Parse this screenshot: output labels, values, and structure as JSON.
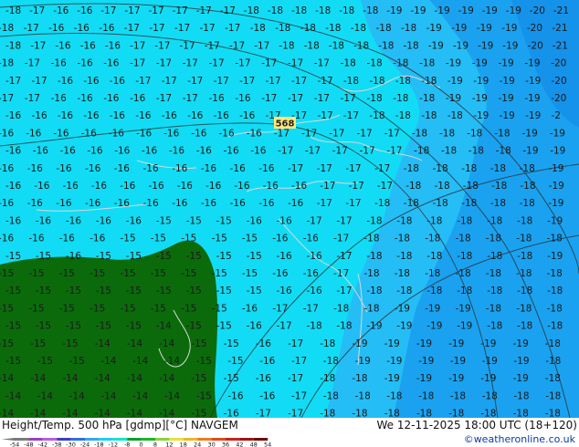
{
  "footer": {
    "title_left": "Height/Temp. 500 hPa [gdmp][°C] NAVGEM",
    "title_right": "We 12-11-2025 18:00 UTC (18+120)",
    "credit": "©weatheronline.co.uk"
  },
  "legend": {
    "ticks": [
      "-54",
      "-48",
      "-42",
      "-38",
      "-30",
      "-24",
      "-18",
      "-12",
      "-8",
      "0",
      "8",
      "12",
      "18",
      "24",
      "30",
      "36",
      "42",
      "48",
      "54"
    ],
    "colors": [
      "#7a7a7a",
      "#9b3fbf",
      "#c05cd8",
      "#3c3cc8",
      "#2f6fe6",
      "#37a6ee",
      "#1ccfef",
      "#11e6c9",
      "#0f9e2d",
      "#1db52a",
      "#8bd33c",
      "#e8e03a",
      "#f1b52a",
      "#ea7b22",
      "#e04a1c",
      "#c9231a",
      "#9d1414",
      "#6e0b0b"
    ]
  },
  "contour_label": "568",
  "colors": {
    "cyan": "#12dcf5",
    "light_blue": "#22b8f5",
    "mid_blue": "#1b9cf0",
    "green": "#0b6b0b"
  },
  "values": [
    {
      "r": 0,
      "items": [
        "-18",
        "-17",
        "-16",
        "-16",
        "-17",
        "-17",
        "-17",
        "-17",
        "-17",
        "-17",
        "-18",
        "-18",
        "-18",
        "-18",
        "-18",
        "-18",
        "-19",
        "-19",
        "-19",
        "-19",
        "-19",
        "-19",
        "-20",
        "-21"
      ]
    },
    {
      "r": 1,
      "items": [
        "-18",
        "-17",
        "-16",
        "-16",
        "-16",
        "-17",
        "-17",
        "-17",
        "-17",
        "-17",
        "-18",
        "-18",
        "-18",
        "-18",
        "-18",
        "-18",
        "-18",
        "-19",
        "-19",
        "-19",
        "-19",
        "-20",
        "-21"
      ]
    },
    {
      "r": 2,
      "items": [
        "-18",
        "-17",
        "-16",
        "-16",
        "-16",
        "-17",
        "-17",
        "-17",
        "-17",
        "-17",
        "-17",
        "-18",
        "-18",
        "-18",
        "-18",
        "-18",
        "-18",
        "-19",
        "-19",
        "-19",
        "-19",
        "-20",
        "-21"
      ]
    },
    {
      "r": 3,
      "items": [
        "-18",
        "-17",
        "-16",
        "-16",
        "-16",
        "-17",
        "-17",
        "-17",
        "-17",
        "-17",
        "-17",
        "-17",
        "-17",
        "-18",
        "-18",
        "-18",
        "-18",
        "-19",
        "-19",
        "-19",
        "-19",
        "-20"
      ]
    },
    {
      "r": 4,
      "items": [
        "-17",
        "-17",
        "-16",
        "-16",
        "-16",
        "-17",
        "-17",
        "-17",
        "-17",
        "-17",
        "-17",
        "-17",
        "-17",
        "-18",
        "-18",
        "-18",
        "-18",
        "-19",
        "-19",
        "-19",
        "-19",
        "-20"
      ]
    },
    {
      "r": 5,
      "items": [
        "-17",
        "-17",
        "-16",
        "-16",
        "-16",
        "-16",
        "-17",
        "-17",
        "-16",
        "-16",
        "-17",
        "-17",
        "-17",
        "-17",
        "-18",
        "-18",
        "-18",
        "-19",
        "-19",
        "-19",
        "-19",
        "-20"
      ]
    },
    {
      "r": 6,
      "items": [
        "-16",
        "-16",
        "-16",
        "-16",
        "-16",
        "-16",
        "-16",
        "-16",
        "-16",
        "-16",
        "-17",
        "-17",
        "-17",
        "-17",
        "-18",
        "-18",
        "-18",
        "-18",
        "-19",
        "-19",
        "-19",
        "-2"
      ]
    },
    {
      "r": 7,
      "items": [
        "-16",
        "-16",
        "-16",
        "-16",
        "-16",
        "-16",
        "-16",
        "-16",
        "-16",
        "-16",
        "-17",
        "-17",
        "-17",
        "-17",
        "-17",
        "-18",
        "-18",
        "-18",
        "-18",
        "-19",
        "-19"
      ]
    },
    {
      "r": 8,
      "items": [
        "-16",
        "-16",
        "-16",
        "-16",
        "-16",
        "-16",
        "-16",
        "-16",
        "-16",
        "-16",
        "-17",
        "-17",
        "-17",
        "-17",
        "-17",
        "-18",
        "-18",
        "-18",
        "-18",
        "-19",
        "-19"
      ]
    },
    {
      "r": 9,
      "items": [
        "-16",
        "-16",
        "-16",
        "-16",
        "-16",
        "-16",
        "-16",
        "-16",
        "-16",
        "-16",
        "-17",
        "-17",
        "-17",
        "-17",
        "-18",
        "-18",
        "-18",
        "-18",
        "-18",
        "-19"
      ]
    },
    {
      "r": 10,
      "items": [
        "-16",
        "-16",
        "-16",
        "-16",
        "-16",
        "-16",
        "-16",
        "-16",
        "-16",
        "-16",
        "-16",
        "-17",
        "-17",
        "-17",
        "-18",
        "-18",
        "-18",
        "-18",
        "-18",
        "-19"
      ]
    },
    {
      "r": 11,
      "items": [
        "-16",
        "-16",
        "-16",
        "-16",
        "-16",
        "-16",
        "-16",
        "-16",
        "-16",
        "-16",
        "-16",
        "-17",
        "-17",
        "-18",
        "-18",
        "-18",
        "-18",
        "-18",
        "-18",
        "-19"
      ]
    },
    {
      "r": 12,
      "items": [
        "-16",
        "-16",
        "-16",
        "-16",
        "-16",
        "-15",
        "-15",
        "-15",
        "-16",
        "-16",
        "-17",
        "-17",
        "-18",
        "-18",
        "-18",
        "-18",
        "-18",
        "-18",
        "-19"
      ]
    },
    {
      "r": 13,
      "items": [
        "-16",
        "-16",
        "-16",
        "-16",
        "-15",
        "-15",
        "-15",
        "-15",
        "-15",
        "-16",
        "-16",
        "-17",
        "-18",
        "-18",
        "-18",
        "-18",
        "-18",
        "-18",
        "-18"
      ]
    },
    {
      "r": 14,
      "items": [
        "-15",
        "-15",
        "-16",
        "-15",
        "-15",
        "-15",
        "-15",
        "-15",
        "-15",
        "-16",
        "-16",
        "-17",
        "-18",
        "-18",
        "-18",
        "-18",
        "-18",
        "-18",
        "-19"
      ]
    },
    {
      "r": 15,
      "items": [
        "-15",
        "-15",
        "-15",
        "-15",
        "-15",
        "-15",
        "-15",
        "-15",
        "-15",
        "-16",
        "-16",
        "-17",
        "-18",
        "-18",
        "-18",
        "-18",
        "-18",
        "-18",
        "-18"
      ]
    },
    {
      "r": 16,
      "items": [
        "-15",
        "-15",
        "-15",
        "-15",
        "-15",
        "-15",
        "-15",
        "-15",
        "-15",
        "-16",
        "-16",
        "-17",
        "-18",
        "-18",
        "-18",
        "-18",
        "-18",
        "-18",
        "-18"
      ]
    },
    {
      "r": 17,
      "items": [
        "-15",
        "-15",
        "-15",
        "-15",
        "-15",
        "-15",
        "-15",
        "-15",
        "-16",
        "-17",
        "-17",
        "-18",
        "-18",
        "-19",
        "-19",
        "-19",
        "-18",
        "-18",
        "-18"
      ]
    },
    {
      "r": 18,
      "items": [
        "-15",
        "-15",
        "-15",
        "-15",
        "-15",
        "-14",
        "-15",
        "-15",
        "-16",
        "-17",
        "-18",
        "-18",
        "-19",
        "-19",
        "-19",
        "-19",
        "-18",
        "-18",
        "-18"
      ]
    },
    {
      "r": 19,
      "items": [
        "-15",
        "-15",
        "-15",
        "-14",
        "-14",
        "-14",
        "-15",
        "-15",
        "-16",
        "-17",
        "-18",
        "-19",
        "-19",
        "-19",
        "-19",
        "-19",
        "-19",
        "-18"
      ]
    },
    {
      "r": 20,
      "items": [
        "-15",
        "-15",
        "-15",
        "-14",
        "-14",
        "-14",
        "-15",
        "-15",
        "-16",
        "-17",
        "-18",
        "-19",
        "-19",
        "-19",
        "-19",
        "-19",
        "-19",
        "-18"
      ]
    },
    {
      "r": 21,
      "items": [
        "-14",
        "-14",
        "-14",
        "-14",
        "-14",
        "-14",
        "-15",
        "-15",
        "-16",
        "-17",
        "-18",
        "-18",
        "-19",
        "-19",
        "-19",
        "-19",
        "-19",
        "-18"
      ]
    },
    {
      "r": 22,
      "items": [
        "-14",
        "-14",
        "-14",
        "-14",
        "-14",
        "-14",
        "-15",
        "-16",
        "-16",
        "-17",
        "-18",
        "-18",
        "-18",
        "-18",
        "-18",
        "-18",
        "-18",
        "-18"
      ]
    },
    {
      "r": 23,
      "items": [
        "-14",
        "-14",
        "-14",
        "-14",
        "-14",
        "-14",
        "-15",
        "-16",
        "-17",
        "-17",
        "-18",
        "-18",
        "-18",
        "-18",
        "-18",
        "-18",
        "-18",
        "-18"
      ]
    }
  ]
}
